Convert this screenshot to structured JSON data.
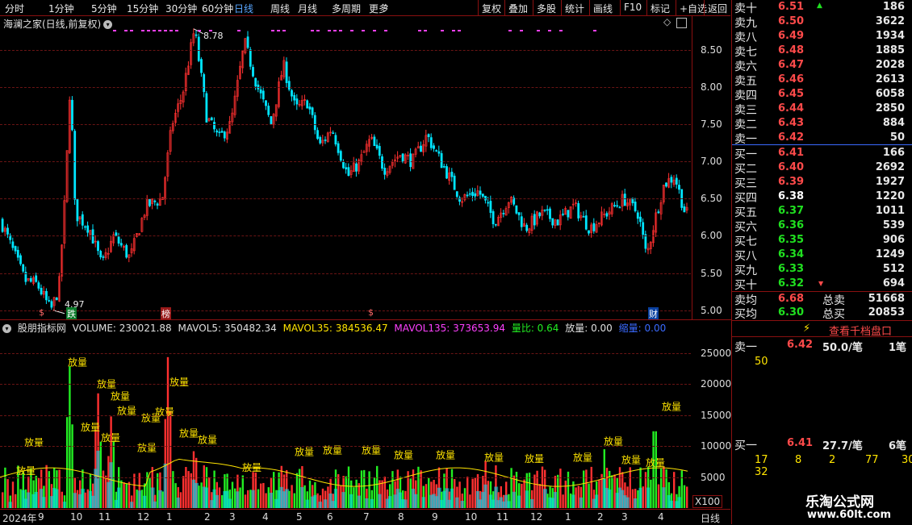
{
  "toolbar": {
    "left": [
      "分时",
      "1分钟",
      "5分钟",
      "15分钟",
      "30分钟",
      "60分钟",
      "日线",
      "周线",
      "月线",
      "多周期",
      "更多"
    ],
    "right": [
      "复权",
      "叠加",
      "多股",
      "统计",
      "画线",
      "F10",
      "标记",
      "+自选",
      "返回"
    ]
  },
  "main": {
    "title": "海澜之家(日线,前复权)",
    "y_ticks": [
      "8.50",
      "8.00",
      "7.50",
      "7.00",
      "6.50",
      "6.00",
      "5.50",
      "5.00"
    ],
    "high_label": "8.78",
    "low_label": "4.97",
    "event_markers": [
      "$",
      "跌",
      "榜",
      "$",
      "财"
    ]
  },
  "sub": {
    "indicator": "股朋指标网",
    "volume": "VOLUME: 230021.88",
    "mavol5": "MAVOL5: 350482.34",
    "mavol35": "MAVOL35: 384536.47",
    "mavol135": "MAVOL135: 373653.94",
    "liangbi": "量比: 0.64",
    "fangliang": "放量: 0.00",
    "suoliang": "缩量: 0.00",
    "y_ticks": [
      "25000",
      "20000",
      "15000",
      "10000",
      "5000"
    ],
    "multiplier": "X100",
    "fang_label": "放量"
  },
  "date_axis": {
    "labels": [
      "2024年",
      "9",
      "10",
      "11",
      "12",
      "1",
      "2",
      "3",
      "4",
      "5",
      "6",
      "7",
      "8",
      "9",
      "10",
      "11",
      "12",
      "1",
      "2",
      "3",
      "4"
    ],
    "period": "日线"
  },
  "orderbook": {
    "asks": [
      {
        "label": "卖十",
        "price": "6.51",
        "vol": "186"
      },
      {
        "label": "卖九",
        "price": "6.50",
        "vol": "3622"
      },
      {
        "label": "卖八",
        "price": "6.49",
        "vol": "1934"
      },
      {
        "label": "卖七",
        "price": "6.48",
        "vol": "1885"
      },
      {
        "label": "卖六",
        "price": "6.47",
        "vol": "2028"
      },
      {
        "label": "卖五",
        "price": "6.46",
        "vol": "2613"
      },
      {
        "label": "卖四",
        "price": "6.45",
        "vol": "6058"
      },
      {
        "label": "卖三",
        "price": "6.44",
        "vol": "2850"
      },
      {
        "label": "卖二",
        "price": "6.43",
        "vol": "884"
      },
      {
        "label": "卖一",
        "price": "6.42",
        "vol": "50"
      }
    ],
    "bids": [
      {
        "label": "买一",
        "price": "6.41",
        "vol": "166"
      },
      {
        "label": "买二",
        "price": "6.40",
        "vol": "2692"
      },
      {
        "label": "买三",
        "price": "6.39",
        "vol": "1927"
      },
      {
        "label": "买四",
        "price": "6.38",
        "vol": "1220"
      },
      {
        "label": "买五",
        "price": "6.37",
        "vol": "1011"
      },
      {
        "label": "买六",
        "price": "6.36",
        "vol": "539"
      },
      {
        "label": "买七",
        "price": "6.35",
        "vol": "906"
      },
      {
        "label": "买八",
        "price": "6.34",
        "vol": "1249"
      },
      {
        "label": "买九",
        "price": "6.33",
        "vol": "512"
      },
      {
        "label": "买十",
        "price": "6.32",
        "vol": "694"
      }
    ],
    "avg_sell_label": "卖均",
    "avg_sell": "6.68",
    "total_sell_label": "总卖",
    "total_sell": "51668",
    "avg_buy_label": "买均",
    "avg_buy": "6.30",
    "total_buy_label": "总买",
    "total_buy": "20853",
    "qianzhi_label": "查看千档盘口",
    "sell1": {
      "label": "卖一",
      "price": "6.42",
      "per": "50.0/笔",
      "count": "1笔",
      "queue": [
        "50"
      ]
    },
    "buy1": {
      "label": "买一",
      "price": "6.41",
      "per": "27.7/笔",
      "count": "6笔",
      "queue": [
        "17",
        "8",
        "2",
        "77",
        "30",
        "32"
      ]
    }
  },
  "watermark": {
    "name": "乐淘公式网",
    "url": "www.60lt.com"
  },
  "colors": {
    "up": "#ff3030",
    "down": "#00e5ff",
    "grid": "#6a1414",
    "ma_pink": "#ff40ff",
    "vol_green": "#22ee22"
  }
}
